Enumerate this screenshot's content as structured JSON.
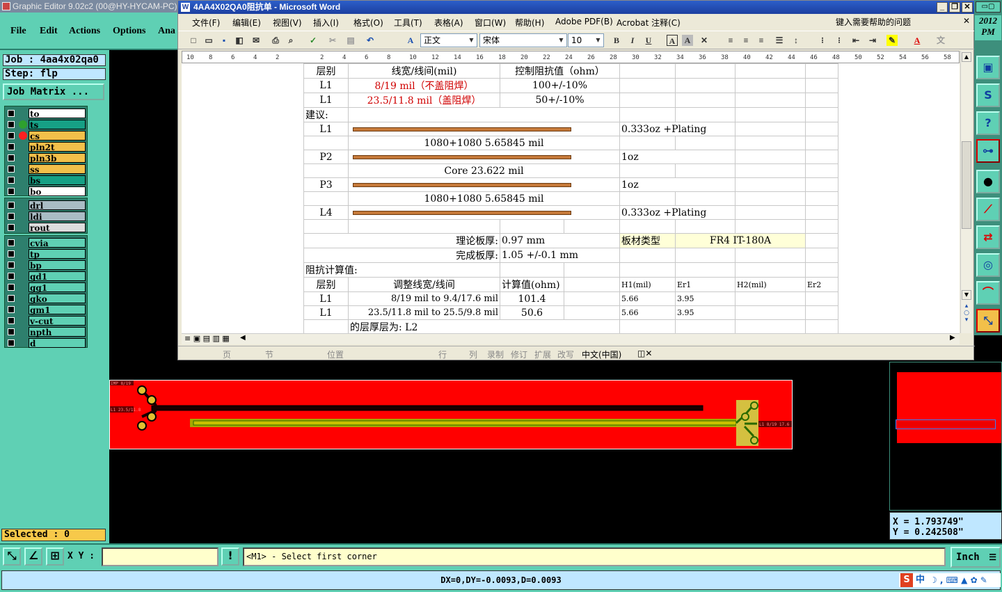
{
  "cam": {
    "title": "Graphic Editor 9.02c2 (00@HY-HYCAM-PC)",
    "menu": [
      "File",
      "Edit",
      "Actions",
      "Options",
      "Ana"
    ],
    "job": "Job : 4aa4x02qa0",
    "step": "Step: flp",
    "job_matrix": "Job Matrix ...",
    "layers_group1": [
      {
        "name": "to",
        "bg": "#ffffff",
        "dot": ""
      },
      {
        "name": "ts",
        "bg": "#16a085",
        "dot": "#2ea02e"
      },
      {
        "name": "cs",
        "bg": "#f2c04a",
        "dot": "#ff2020"
      },
      {
        "name": "pln2t",
        "bg": "#f2c04a",
        "dot": ""
      },
      {
        "name": "pln3b",
        "bg": "#f2c04a",
        "dot": ""
      },
      {
        "name": "ss",
        "bg": "#f2c04a",
        "dot": ""
      },
      {
        "name": "bs",
        "bg": "#16a085",
        "dot": ""
      },
      {
        "name": "bo",
        "bg": "#ffffff",
        "dot": ""
      }
    ],
    "layers_group2": [
      {
        "name": "drl",
        "bg": "#a9bcc4"
      },
      {
        "name": "ldi",
        "bg": "#a9bcc4"
      },
      {
        "name": "rout",
        "bg": "#dcdcdc"
      }
    ],
    "layers_group3": [
      {
        "name": "cvia"
      },
      {
        "name": "tp"
      },
      {
        "name": "bp"
      },
      {
        "name": "gd1"
      },
      {
        "name": "gg1"
      },
      {
        "name": "gko"
      },
      {
        "name": "gm1"
      },
      {
        "name": "v-cut"
      },
      {
        "name": "npth"
      },
      {
        "name": "d"
      }
    ],
    "selected": "Selected : 0",
    "date_top": "2012",
    "date_bottom": "PM",
    "coord_x": "X =  1.793749\"",
    "coord_y": "Y =  0.242508\"",
    "xy_label": "X Y :",
    "xy_value": "",
    "prompt": "<M1> - Select first corner",
    "units": "Inch",
    "delta": "DX=0,DY=-0.0093,D=0.0093",
    "board_label_left1": "IMP 8/19",
    "board_label_left2": "L1 23.5/11.8",
    "board_label_right": "L1 8/19 17.6",
    "ime_text": "中"
  },
  "word": {
    "title": "4AA4X02QA0阻抗单 - Microsoft Word",
    "title_icon": "W",
    "menu": [
      "文件(F)",
      "编辑(E)",
      "视图(V)",
      "插入(I)",
      "格式(O)",
      "工具(T)",
      "表格(A)",
      "窗口(W)",
      "帮助(H)",
      "Adobe PDF(B)",
      "Acrobat 注释(C)"
    ],
    "help_placeholder": "键入需要帮助的问题",
    "style": "正文",
    "font": "宋体",
    "size": "10",
    "status": [
      "页",
      "节",
      "位置",
      "行",
      "列",
      "录制",
      "修订",
      "扩展",
      "改写",
      "中文(中国)"
    ],
    "ruler_ticks": [
      "10",
      "8",
      "6",
      "4",
      "2",
      "",
      "2",
      "4",
      "6",
      "8",
      "10",
      "12",
      "14",
      "16",
      "18",
      "20",
      "22",
      "24",
      "26",
      "28",
      "30",
      "32",
      "34",
      "36",
      "38",
      "40",
      "42",
      "44",
      "46",
      "48",
      "50",
      "52",
      "54",
      "56",
      "58"
    ]
  },
  "table": {
    "h_layer": "层别",
    "h_width": "线宽/线间(mil)",
    "h_imp": "控制阻抗值（ohm）",
    "r1_layer": "L1",
    "r1_width": "8/19 mil（不盖阻焊）",
    "r1_imp": "100+/-10%",
    "r2_layer": "L1",
    "r2_width": "23.5/11.8 mil（盖阻焊）",
    "r2_imp": "50+/-10%",
    "suggest": "建议:",
    "s_l1": "L1",
    "s_l1_cu": "0.333oz +Plating",
    "s_pp1": "1080+1080    5.65845 mil",
    "s_p2": "P2",
    "s_p2_cu": "1oz",
    "s_core": "Core   23.622 mil",
    "s_p3": "P3",
    "s_p3_cu": "1oz",
    "s_pp2": "1080+1080    5.65845 mil",
    "s_l4": "L4",
    "s_l4_cu": "0.333oz +Plating",
    "thick_label": "理论板厚:",
    "thick_value": "0.97 mm",
    "mat_label": "板材类型",
    "mat_value": "FR4 IT-180A",
    "finish_label": "完成板厚:",
    "finish_value": "1.05 +/-0.1 mm",
    "calc_title": "阻抗计算值:",
    "c_layer": "层别",
    "c_width": "调整线宽/线间",
    "c_val": "计算值(ohm)",
    "c_h1": "H1(mil)",
    "c_er1": "Er1",
    "c_h2": "H2(mil)",
    "c_er2": "Er2",
    "c1_layer": "L1",
    "c1_width": "8/19 mil to 9.4/17.6 mil",
    "c1_val": "101.4",
    "c1_h1": "5.66",
    "c1_er1": "3.95",
    "c2_layer": "L1",
    "c2_width": "23.5/11.8 mil to 25.5/9.8 mil",
    "c2_val": "50.6",
    "c2_h1": "5.66",
    "c2_er1": "3.95",
    "partial": "的层厚层为: L2"
  }
}
